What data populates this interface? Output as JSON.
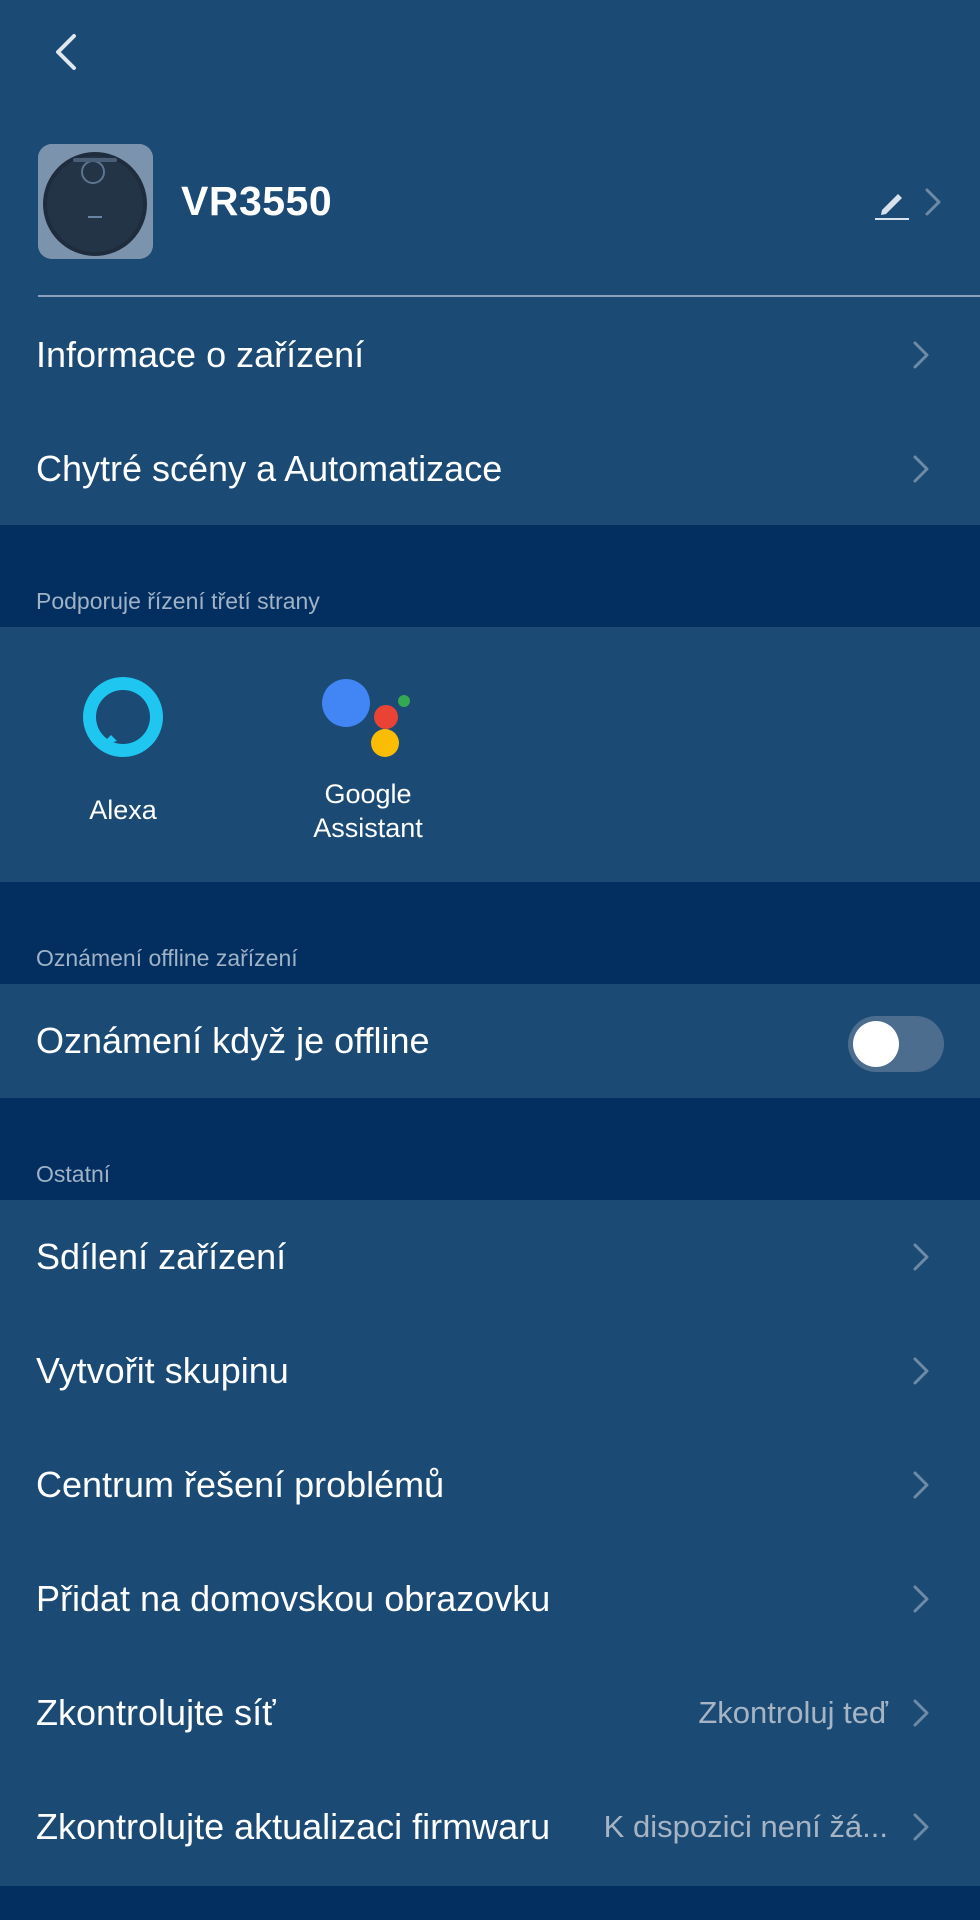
{
  "device": {
    "name": "VR3550"
  },
  "top_menu": [
    {
      "label": "Informace o zařízení"
    },
    {
      "label": "Chytré scény a Automatizace"
    }
  ],
  "third_party": {
    "section_title": "Podporuje řízení třetí strany",
    "items": [
      {
        "label": "Alexa",
        "icon": "alexa-icon"
      },
      {
        "label_line1": "Google",
        "label_line2": "Assistant",
        "icon": "google-assistant-icon"
      }
    ]
  },
  "offline": {
    "section_title": "Oznámení offline zařízení",
    "toggle_label": "Oznámení když je offline",
    "toggle_on": false
  },
  "other": {
    "section_title": "Ostatní",
    "items": [
      {
        "label": "Sdílení zařízení",
        "value": ""
      },
      {
        "label": "Vytvořit skupinu",
        "value": ""
      },
      {
        "label": "Centrum řešení problémů",
        "value": ""
      },
      {
        "label": "Přidat na domovskou obrazovku",
        "value": ""
      },
      {
        "label": "Zkontrolujte síť",
        "value": "Zkontroluj teď"
      },
      {
        "label": "Zkontrolujte aktualizaci firmwaru",
        "value": "K dispozici není žá..."
      }
    ]
  },
  "colors": {
    "background": "#032f60",
    "panel": "#1b4a75",
    "alexa": "#1ec6f0",
    "google_blue": "#4285f4",
    "google_red": "#ea4335",
    "google_yellow": "#fbbc04",
    "google_green": "#34a853"
  }
}
